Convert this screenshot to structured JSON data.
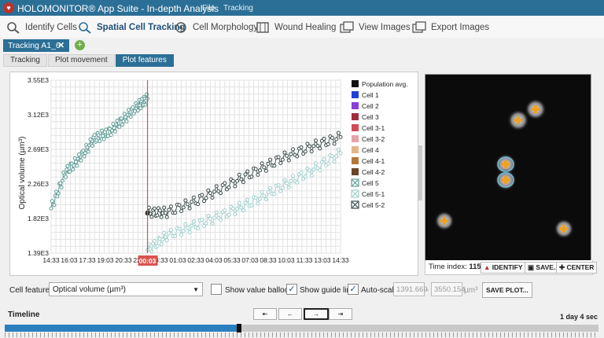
{
  "window": {
    "logo_glyph": "♥",
    "title": "HOLOMONITOR® App Suite - In-depth Analysis",
    "menu": [
      "File",
      "Tracking"
    ]
  },
  "toolbar": {
    "items": [
      {
        "label": "Identify Cells",
        "icon": "identify-cells-icon"
      },
      {
        "label": "Spatial Cell Tracking",
        "icon": "cell-tracking-icon",
        "active": true
      },
      {
        "label": "Cell Morphology",
        "icon": "cell-morphology-icon"
      },
      {
        "label": "Wound Healing",
        "icon": "wound-healing-icon"
      },
      {
        "label": "View Images",
        "icon": "view-images-icon"
      },
      {
        "label": "Export Images",
        "icon": "export-images-icon"
      }
    ]
  },
  "document_tab": {
    "label": "Tracking A1_6",
    "close": "✕",
    "add": "+"
  },
  "subtabs": [
    "Tracking",
    "Plot movement",
    "Plot features"
  ],
  "subtab_active": 2,
  "chart_data": {
    "type": "scatter",
    "ylabel": "Optical volume (µm³)",
    "y_ticks": [
      "3.55E3",
      "3.12E3",
      "2.69E3",
      "2.26E3",
      "1.82E3",
      "1.39E3"
    ],
    "ylim": [
      1391.669,
      3550.154
    ],
    "x_ticks": [
      "14:33",
      "16:03",
      "17:33",
      "19:03",
      "20:33",
      "22:03",
      "23:33",
      "01:03",
      "02:33",
      "04:03",
      "05:33",
      "07:03",
      "08:33",
      "10:03",
      "11:33",
      "13:03",
      "14:33"
    ],
    "guide_line_label": "00:03",
    "guide_line_fraction": 0.333,
    "population_avg_value": 1890,
    "grid": true,
    "legend_position": "right",
    "series": [
      {
        "name": "Cell 5",
        "color": "#5f9c96",
        "segment": "before-split",
        "x": [
          0,
          0.05,
          0.1,
          0.15,
          0.2,
          0.25,
          0.3,
          0.333
        ],
        "y": [
          1950,
          2400,
          2580,
          2820,
          2900,
          3060,
          3230,
          3320
        ]
      },
      {
        "name": "Cell 5-1",
        "color": "#9fd0cc",
        "segment": "after-split",
        "x": [
          0.333,
          0.4,
          0.5,
          0.6,
          0.7,
          0.8,
          0.9,
          1.0
        ],
        "y": [
          1430,
          1610,
          1740,
          1880,
          2040,
          2230,
          2420,
          2640
        ]
      },
      {
        "name": "Cell 5-2",
        "color": "#3b4a4a",
        "segment": "after-split",
        "x": [
          0.333,
          0.4,
          0.5,
          0.6,
          0.7,
          0.8,
          0.9,
          1.0
        ],
        "y": [
          1900,
          1900,
          2040,
          2220,
          2400,
          2580,
          2720,
          2840
        ]
      }
    ]
  },
  "legend": [
    {
      "name": "Population avg.",
      "color": "#111111",
      "marker": "filled"
    },
    {
      "name": "Cell 1",
      "color": "#1f3fd6",
      "marker": "filled"
    },
    {
      "name": "Cell 2",
      "color": "#8a3fd6",
      "marker": "filled"
    },
    {
      "name": "Cell 3",
      "color": "#a02c3c",
      "marker": "filled"
    },
    {
      "name": "Cell 3-1",
      "color": "#d24a57",
      "marker": "filled"
    },
    {
      "name": "Cell 3-2",
      "color": "#e8a3a8",
      "marker": "filled"
    },
    {
      "name": "Cell 4",
      "color": "#e2b48a",
      "marker": "filled"
    },
    {
      "name": "Cell 4-1",
      "color": "#b5763a",
      "marker": "filled"
    },
    {
      "name": "Cell 4-2",
      "color": "#6a4526",
      "marker": "filled"
    },
    {
      "name": "Cell 5",
      "color": "#5f9c96",
      "marker": "cross"
    },
    {
      "name": "Cell 5-1",
      "color": "#9fd0cc",
      "marker": "cross"
    },
    {
      "name": "Cell 5-2",
      "color": "#3b4a4a",
      "marker": "cross"
    }
  ],
  "image_panel": {
    "time_index_label": "Time index:",
    "time_index_value": "115",
    "buttons": [
      {
        "label": "IDENTIFY",
        "icon": "identify-icon"
      },
      {
        "label": "SAVE..",
        "icon": "camera-icon"
      },
      {
        "label": "CENTER",
        "icon": "crosshair-icon"
      }
    ]
  },
  "controls": {
    "cell_feature_label": "Cell feature:",
    "cell_feature_value": "Optical volume (µm³)",
    "show_value_balloons": {
      "label": "Show value balloons",
      "checked": false
    },
    "show_guide_line": {
      "label": "Show guide line",
      "checked": true
    },
    "auto_scale": {
      "label": "Auto-scale",
      "checked": true
    },
    "min_value": "1391.669",
    "range_sep": "-",
    "max_value": "3550.154",
    "unit": "µm³",
    "save_plot": "SAVE PLOT..."
  },
  "timeline": {
    "label": "Timeline",
    "duration": "1 day 4 sec",
    "progress": 0.395,
    "buttons": [
      {
        "glyph": "⇤",
        "icon": "first-frame-icon"
      },
      {
        "glyph": "←",
        "icon": "previous-frame-icon"
      },
      {
        "glyph": "→",
        "icon": "next-frame-icon",
        "active": true
      },
      {
        "glyph": "⇥",
        "icon": "last-frame-icon"
      }
    ]
  }
}
